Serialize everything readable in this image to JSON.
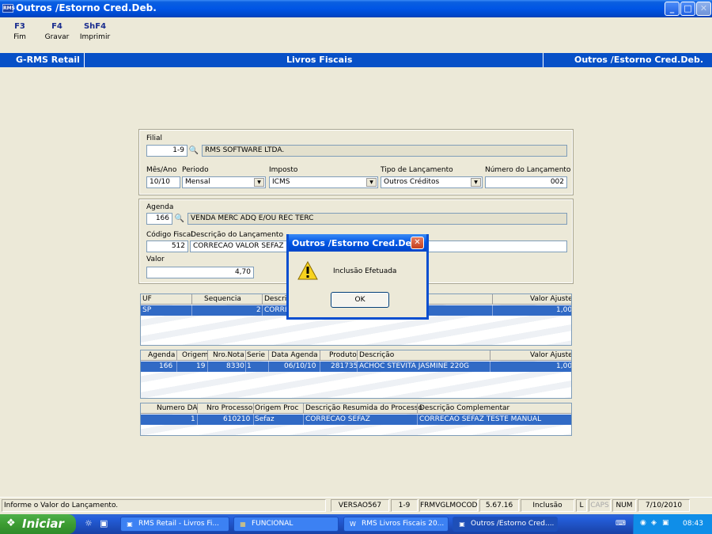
{
  "window": {
    "app_icon_text": "RMS",
    "title": "Outros /Estorno Cred.Deb.",
    "minimize": "_",
    "maximize": "□",
    "close": "✕"
  },
  "toolbar": [
    {
      "key": "F3",
      "label": "Fim"
    },
    {
      "key": "F4",
      "label": "Gravar"
    },
    {
      "key": "ShF4",
      "label": "Imprimir"
    }
  ],
  "band": {
    "left": "G-RMS Retail",
    "center": "Livros Fiscais",
    "right": "Outros /Estorno Cred.Deb."
  },
  "form": {
    "filial_label": "Filial",
    "filial_code": "1-9",
    "filial_name": "RMS SOFTWARE LTDA.",
    "mesano_label": "Mês/Ano",
    "mesano_value": "10/10",
    "periodo_label": "Periodo",
    "periodo_value": "Mensal",
    "imposto_label": "Imposto",
    "imposto_value": "ICMS",
    "tipo_label": "Tipo de Lançamento",
    "tipo_value": "Outros Créditos",
    "numero_label": "Número do Lançamento",
    "numero_value": "002",
    "agenda_label": "Agenda",
    "agenda_code": "166",
    "agenda_desc": "VENDA MERC ADQ E/OU REC TERC",
    "codfiscal_label": "Código Fiscal",
    "codfiscal_value": "512",
    "descricao_label": "Descrição do Lançamento",
    "descricao_value": "CORRECAO VALOR SEFAZ",
    "valor_label": "Valor",
    "valor_value": "4,70"
  },
  "grid1": {
    "headers": [
      "UF",
      "Sequencia",
      "Descriç",
      "Valor Ajuste"
    ],
    "row": [
      "SP",
      "2",
      "CORRE",
      "1,00"
    ]
  },
  "grid2": {
    "headers": [
      "Agenda",
      "Origem",
      "Nro.Nota",
      "Serie",
      "Data Agenda",
      "Produto",
      "Descrição",
      "Valor Ajuste"
    ],
    "row": [
      "166",
      "19",
      "8330",
      "1",
      "06/10/10",
      "281735",
      "ACHOC STEVITA JASMINE 220G",
      "1,00"
    ]
  },
  "grid3": {
    "headers": [
      "Numero DA",
      "Nro Processo",
      "Origem Proc",
      "Descrição Resumida do Processo",
      "Descrição Complementar"
    ],
    "row": [
      "1",
      "610210",
      "Sefaz",
      "CORRECAO SEFAZ",
      "CORRECAO SEFAZ TESTE MANUAL"
    ]
  },
  "dialog": {
    "title": "Outros /Estorno Cred.Deb.",
    "message": "Inclusão Efetuada",
    "ok": "OK",
    "close": "✕",
    "icon": "warning-icon"
  },
  "statusbar": {
    "message": "Informe o Valor do Lançamento.",
    "version": "VERSAO567",
    "filial": "1-9",
    "form": "FRMVGLMOCOD",
    "build": "5.67.16",
    "mode": "Inclusão",
    "l": "L",
    "caps": "CAPS",
    "num": "NUM",
    "date": "7/10/2010"
  },
  "taskbar": {
    "start": "Iniciar",
    "buttons": [
      "RMS Retail - Livros Fi...",
      "FUNCIONAL",
      "RMS Livros Fiscais 20...",
      "Outros /Estorno Cred...."
    ],
    "clock": "08:43"
  }
}
